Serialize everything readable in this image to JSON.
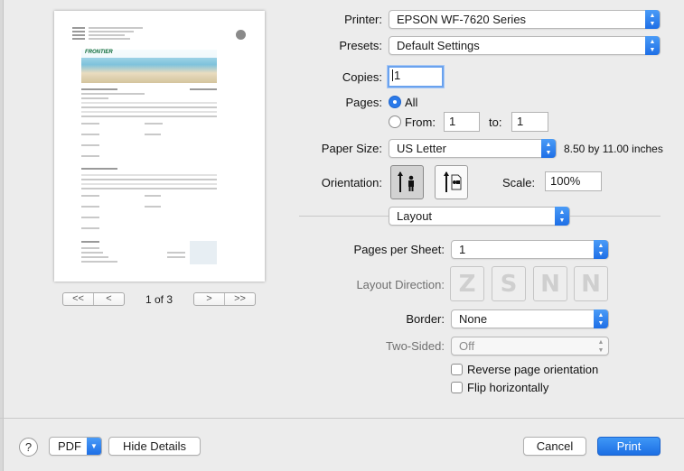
{
  "preview": {
    "page_indicator": "1 of 3",
    "nav": {
      "first": "<<",
      "prev": "<",
      "next": ">",
      "last": ">>"
    },
    "logo_text": "FRONTIER"
  },
  "printer": {
    "label": "Printer:",
    "value": "EPSON WF-7620 Series"
  },
  "presets": {
    "label": "Presets:",
    "value": "Default Settings"
  },
  "copies": {
    "label": "Copies:",
    "value": "1"
  },
  "pages": {
    "label": "Pages:",
    "all_label": "All",
    "from_label": "From:",
    "from_value": "1",
    "to_label": "to:",
    "to_value": "1",
    "selected": "All"
  },
  "paper_size": {
    "label": "Paper Size:",
    "value": "US Letter",
    "dimensions": "8.50 by 11.00 inches"
  },
  "orientation": {
    "label": "Orientation:",
    "selected": "portrait"
  },
  "scale": {
    "label": "Scale:",
    "value": "100%"
  },
  "section": {
    "value": "Layout"
  },
  "layout": {
    "pages_per_sheet": {
      "label": "Pages per Sheet:",
      "value": "1"
    },
    "layout_direction": {
      "label": "Layout Direction:",
      "options": [
        "Z",
        "S",
        "N",
        "N"
      ]
    },
    "border": {
      "label": "Border:",
      "value": "None"
    },
    "two_sided": {
      "label": "Two-Sided:",
      "value": "Off"
    },
    "reverse_orientation": {
      "label": "Reverse page orientation",
      "checked": false
    },
    "flip_horizontally": {
      "label": "Flip horizontally",
      "checked": false
    }
  },
  "footer": {
    "help": "?",
    "pdf": "PDF",
    "hide_details": "Hide Details",
    "cancel": "Cancel",
    "print": "Print"
  },
  "colors": {
    "accent": "#1c6fe4",
    "background": "#ececec"
  }
}
